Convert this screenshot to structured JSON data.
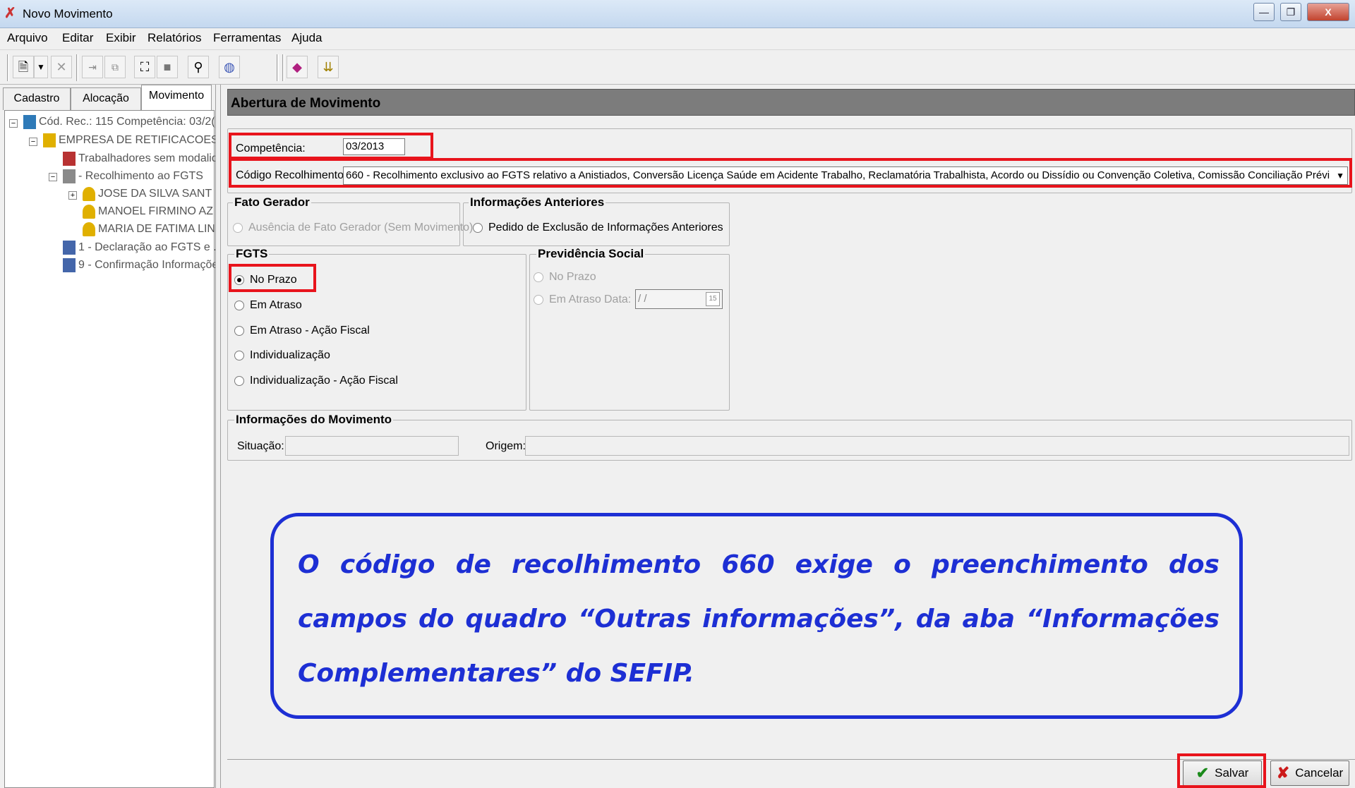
{
  "window": {
    "title": "Novo Movimento",
    "minimize": "—",
    "restore": "❐",
    "close": "X"
  },
  "menu": [
    "Arquivo",
    "Editar",
    "Exibir",
    "Relatórios",
    "Ferramentas",
    "Ajuda"
  ],
  "toolbar_icons": [
    "new-document-icon",
    "dropdown-arrow-icon",
    "delete-icon",
    "move-icon",
    "copy-icon",
    "tree-icon",
    "stop-icon",
    "find-binoculars-icon",
    "globe-icon",
    "bookmark-icon",
    "merge-icon"
  ],
  "left_tabs": [
    "Cadastro",
    "Alocação",
    "Movimento"
  ],
  "tree": [
    {
      "label": "Cód. Rec.: 115 Competência: 03/2("
    },
    {
      "label": "EMPRESA DE RETIFICACOES"
    },
    {
      "label": "Trabalhadores sem modalid"
    },
    {
      "label": "- Recolhimento ao FGTS"
    },
    {
      "label": "JOSE DA SILVA SANT"
    },
    {
      "label": "MANOEL FIRMINO AZ"
    },
    {
      "label": "MARIA DE FATIMA LIN"
    },
    {
      "label": "1 - Declaração ao FGTS e ."
    },
    {
      "label": "9 - Confirmação Informaçõe"
    }
  ],
  "panel": {
    "title": "Abertura de Movimento"
  },
  "competencia": {
    "label": "Competência:",
    "value": "03/2013"
  },
  "codigo": {
    "label": "Código Recolhimento:",
    "value": "660 - Recolhimento exclusivo ao FGTS relativo a Anistiados, Conversão Licença Saúde em Acidente Trabalho, Reclamatória Trabalhista, Acordo ou Dissídio ou Convenção Coletiva, Comissão Conciliação Prévi"
  },
  "fato_gerador": {
    "legend": "Fato Gerador",
    "option": "Ausência de Fato Gerador (Sem Movimento)"
  },
  "info_anteriores": {
    "legend": "Informações Anteriores",
    "option": "Pedido de Exclusão de Informações Anteriores"
  },
  "fgts": {
    "legend": "FGTS",
    "options": [
      "No Prazo",
      "Em Atraso",
      "Em Atraso - Ação Fiscal",
      "Individualização",
      "Individualização - Ação Fiscal"
    ],
    "selected": "No Prazo"
  },
  "previdencia": {
    "legend": "Previdência Social",
    "opt_no_prazo": "No Prazo",
    "opt_em_atraso": "Em Atraso",
    "data_label": "Data:",
    "data_value": " / /",
    "calendar": "15"
  },
  "info_movimento": {
    "legend": "Informações do Movimento",
    "situacao_label": "Situação:",
    "origem_label": "Origem:"
  },
  "callout_text": "O código de recolhimento 660 exige o preenchimento dos campos do quadro “Outras informações”, da aba “Informações Complementares” do SEFIP.",
  "buttons": {
    "salvar": "Salvar",
    "cancelar": "Cancelar"
  },
  "colors": {
    "highlight_red": "#e8141c",
    "callout_blue": "#1d2fd4",
    "panel_header": "#7c7c7c"
  }
}
